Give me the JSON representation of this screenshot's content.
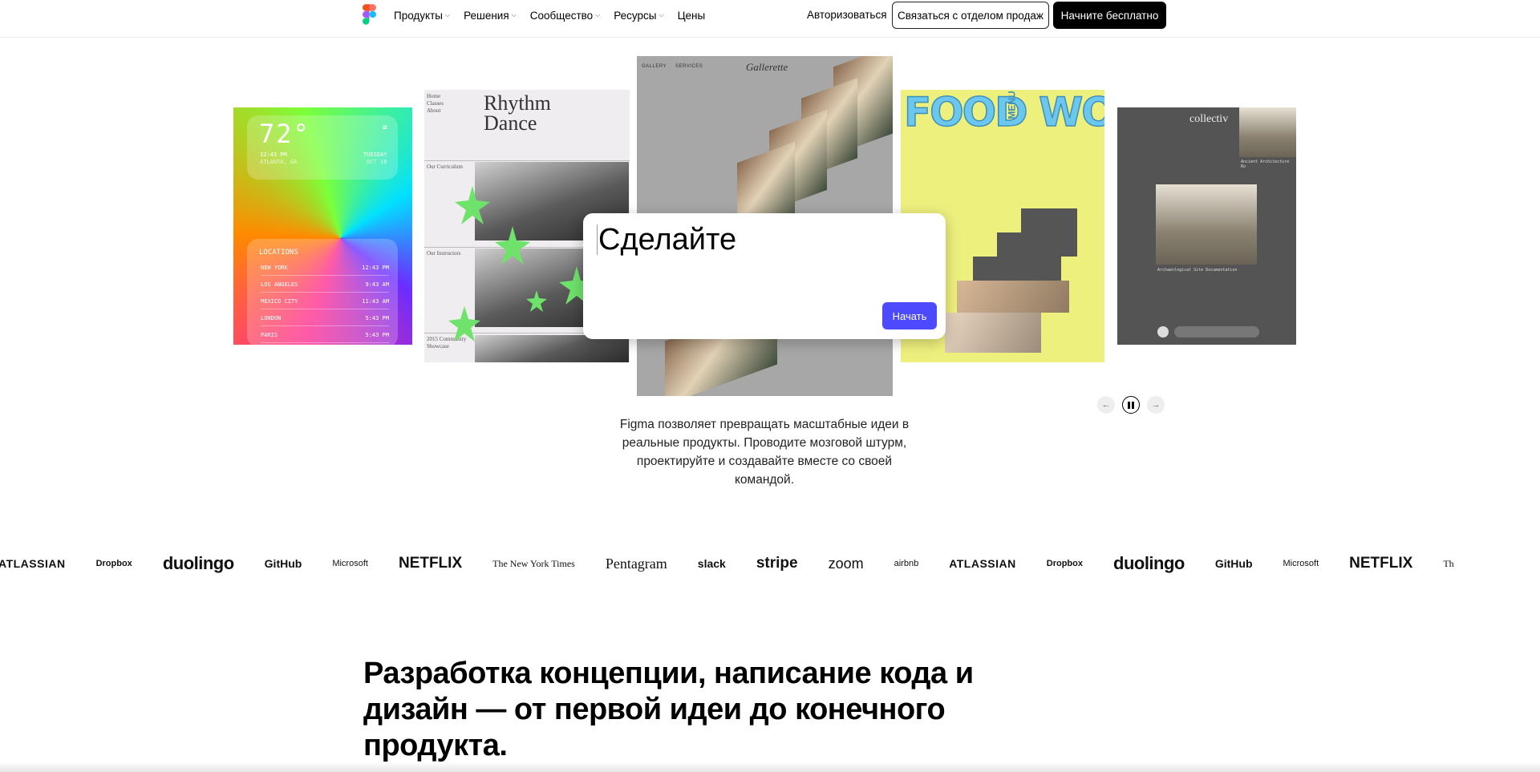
{
  "header": {
    "nav": [
      {
        "label": "Продукты"
      },
      {
        "label": "Решения"
      },
      {
        "label": "Сообщество"
      },
      {
        "label": "Ресурсы"
      },
      {
        "label": "Цены"
      }
    ],
    "login_label": "Авторизоваться",
    "sales_label": "Связаться с отделом продаж",
    "free_label": "Начните бесплатно",
    "logo_colors": [
      "#f24e1e",
      "#ff7262",
      "#a259ff",
      "#1abcfe",
      "#0acf83"
    ]
  },
  "cards": {
    "weather": {
      "temp": "72°",
      "time": "12:43 PM",
      "city": "ATLANTA, GA",
      "day": "TUESDAY",
      "date": "OCT 18",
      "locations_title": "LOCATIONS",
      "locations": [
        {
          "city": "NEW YORK",
          "time": "12:43 PM"
        },
        {
          "city": "LOS ANGELES",
          "time": "9:43 AM"
        },
        {
          "city": "MEXICO CITY",
          "time": "11:43 AM"
        },
        {
          "city": "LONDON",
          "time": "5:43 PM"
        },
        {
          "city": "PARIS",
          "time": "5:43 PM"
        }
      ]
    },
    "dance": {
      "title_line1": "Rhythm",
      "title_line2": "Dance",
      "menu": [
        "Home",
        "Classes",
        "About"
      ],
      "section1": "Our Curriculum",
      "section2": "Our Instructors",
      "section3": "2015 Community Showcase"
    },
    "gallery": {
      "title": "Gallerette",
      "nav1": "GALLERY",
      "nav2": "SERVICES"
    },
    "food": {
      "title": "FOOD WORKS",
      "menu": "MENU"
    },
    "collectiv": {
      "title": "collectiv",
      "caption1": "Ancient Architecture Ro",
      "caption2": "Archaeological Site Documentation"
    }
  },
  "prompt": {
    "text": "Сделайте",
    "button": "Начать",
    "accent": "#4d49fc"
  },
  "controls": {
    "prev_icon": "arrow-left-icon",
    "pause_icon": "pause-icon",
    "next_icon": "arrow-right-icon"
  },
  "description": "Figma позволяет превращать масштабные идеи в реальные продукты. Проводите мозговой штурм, проектируйте и создавайте вместе со своей командой.",
  "logos": [
    "ATLASSIAN",
    "Dropbox",
    "duolingo",
    "GitHub",
    "Microsoft",
    "NETFLIX",
    "The New York Times",
    "Pentagram",
    "slack",
    "stripe",
    "zoom",
    "airbnb",
    "ATLASSIAN",
    "Dropbox",
    "duolingo",
    "GitHub",
    "Microsoft",
    "NETFLIX",
    "Th"
  ],
  "headline": "Разработка концепции, написание кода и дизайн — от первой идеи до конечного продукта."
}
